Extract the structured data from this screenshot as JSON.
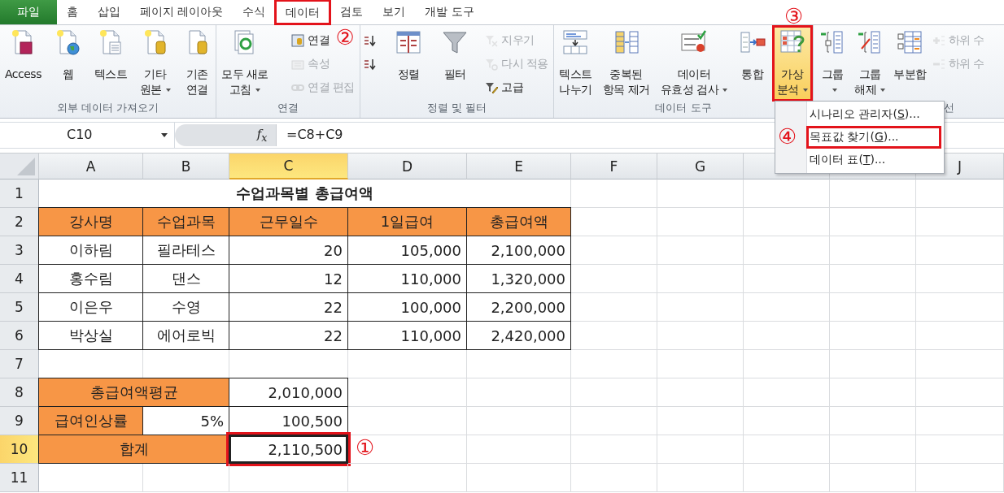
{
  "tabs": [
    {
      "label": "파일",
      "kind": "file",
      "selected": false
    },
    {
      "label": "홈",
      "kind": "tab",
      "selected": false
    },
    {
      "label": "삽입",
      "kind": "tab",
      "selected": false
    },
    {
      "label": "페이지 레이아웃",
      "kind": "tab",
      "selected": false
    },
    {
      "label": "수식",
      "kind": "tab",
      "selected": false
    },
    {
      "label": "데이터",
      "kind": "tab",
      "selected": true,
      "highlight_box": true,
      "callout": "②"
    },
    {
      "label": "검토",
      "kind": "tab",
      "selected": false
    },
    {
      "label": "보기",
      "kind": "tab",
      "selected": false
    },
    {
      "label": "개발 도구",
      "kind": "tab",
      "selected": false
    }
  ],
  "ribbon": {
    "groups": [
      {
        "label": "외부 데이터 가져오기",
        "items": [
          {
            "kind": "big",
            "label_lines": [
              "Access"
            ],
            "has_menu": false
          },
          {
            "kind": "big",
            "label_lines": [
              "웹"
            ],
            "has_menu": false
          },
          {
            "kind": "big",
            "label_lines": [
              "텍스트"
            ],
            "has_menu": false
          },
          {
            "kind": "big",
            "label_lines": [
              "기타",
              "원본"
            ],
            "has_menu": true
          },
          {
            "kind": "big",
            "label_lines": [
              "기존",
              "연결"
            ],
            "has_menu": false
          }
        ]
      },
      {
        "label": "연결",
        "items": [
          {
            "kind": "big",
            "label_lines": [
              "모두 새로",
              "고침"
            ],
            "has_menu": true
          },
          {
            "kind": "stack",
            "items": [
              {
                "label": "연결",
                "disabled": false
              },
              {
                "label": "속성",
                "disabled": true
              },
              {
                "label": "연결 편집",
                "disabled": true
              }
            ]
          }
        ]
      },
      {
        "label": "정렬 및 필터",
        "items": [
          {
            "kind": "stack",
            "items": [
              {
                "disabled": false
              },
              {
                "disabled": false
              }
            ]
          },
          {
            "kind": "big",
            "label_lines": [
              "정렬"
            ],
            "has_menu": false
          },
          {
            "kind": "big",
            "label_lines": [
              "필터"
            ],
            "has_menu": false
          },
          {
            "kind": "stack",
            "items": [
              {
                "label": "지우기",
                "disabled": true
              },
              {
                "label": "다시 적용",
                "disabled": true
              },
              {
                "label": "고급",
                "disabled": false
              }
            ]
          }
        ]
      },
      {
        "label": "데이터 도구",
        "items": [
          {
            "kind": "big",
            "label_lines": [
              "텍스트",
              "나누기"
            ],
            "has_menu": false
          },
          {
            "kind": "big",
            "label_lines": [
              "중복된",
              "항목 제거"
            ],
            "has_menu": false
          },
          {
            "kind": "big",
            "label_lines": [
              "데이터",
              "유효성 검사"
            ],
            "has_menu": true
          },
          {
            "kind": "big",
            "label_lines": [
              "통합"
            ],
            "has_menu": false
          },
          {
            "kind": "big",
            "label_lines": [
              "가상",
              "분석"
            ],
            "has_menu": true,
            "pressed": true,
            "highlight_box": true,
            "callout": "③"
          }
        ]
      },
      {
        "label": "선",
        "items": [
          {
            "kind": "big",
            "label_lines": [
              "그룹"
            ],
            "has_menu": true
          },
          {
            "kind": "big",
            "label_lines": [
              "그룹",
              "해제"
            ],
            "has_menu": true
          },
          {
            "kind": "big",
            "label_lines": [
              "부분합"
            ],
            "has_menu": false
          },
          {
            "kind": "stack",
            "items": [
              {
                "label": "하위 수",
                "disabled": true
              },
              {
                "label": "하위 수",
                "disabled": true
              }
            ]
          }
        ]
      }
    ]
  },
  "menu": {
    "items": [
      {
        "before": "시나리오 관리자(",
        "key": "S",
        "after": ")...",
        "highlight_box": false
      },
      {
        "before": "목표값 찾기(",
        "key": "G",
        "after": ")...",
        "highlight_box": true,
        "callout": "④"
      },
      {
        "before": "데이터 표(",
        "key": "T",
        "after": ")...",
        "highlight_box": false
      }
    ]
  },
  "formula_bar": {
    "name_box": "C10",
    "function_label": "f$_{x}$",
    "formula": "=C8+C9"
  },
  "sheet": {
    "columns": [
      {
        "label": "A",
        "selected": false
      },
      {
        "label": "B",
        "selected": false
      },
      {
        "label": "C",
        "selected": true
      },
      {
        "label": "D",
        "selected": false
      },
      {
        "label": "E",
        "selected": false
      },
      {
        "label": "F",
        "selected": false
      },
      {
        "label": "G",
        "selected": false
      },
      {},
      {},
      {
        "label": "J",
        "selected": false
      }
    ],
    "rows": [
      {
        "number": "1",
        "kind": "title",
        "selected": false,
        "cells": [
          "수업과목별 총급여액"
        ]
      },
      {
        "number": "2",
        "kind": "header",
        "selected": false,
        "cells": [
          "강사명",
          "수업과목",
          "근무일수",
          "1일급여",
          "총급여액"
        ]
      },
      {
        "number": "3",
        "kind": "data",
        "selected": false,
        "cells": [
          "이하림",
          "필라테스",
          "20",
          "105,000",
          "2,100,000"
        ]
      },
      {
        "number": "4",
        "kind": "data",
        "selected": false,
        "cells": [
          "홍수림",
          "댄스",
          "12",
          "110,000",
          "1,320,000"
        ]
      },
      {
        "number": "5",
        "kind": "data",
        "selected": false,
        "cells": [
          "이은우",
          "수영",
          "22",
          "100,000",
          "2,200,000"
        ]
      },
      {
        "number": "6",
        "kind": "data",
        "selected": false,
        "cells": [
          "박상실",
          "에어로빅",
          "22",
          "110,000",
          "2,420,000"
        ]
      },
      {
        "number": "7",
        "kind": "blank",
        "selected": false
      },
      {
        "number": "8",
        "kind": "summary",
        "selected": false,
        "cells": [
          "총급여액평균",
          "2,010,000"
        ]
      },
      {
        "number": "9",
        "kind": "rate",
        "selected": false,
        "cells": [
          "급여인상률",
          "5%",
          "100,500"
        ]
      },
      {
        "number": "10",
        "kind": "summary",
        "selected": true,
        "highlight_box": true,
        "callout": "①",
        "cells": [
          "합계",
          "2,110,500"
        ]
      },
      {
        "number": "11",
        "kind": "blank",
        "selected": false
      }
    ]
  }
}
